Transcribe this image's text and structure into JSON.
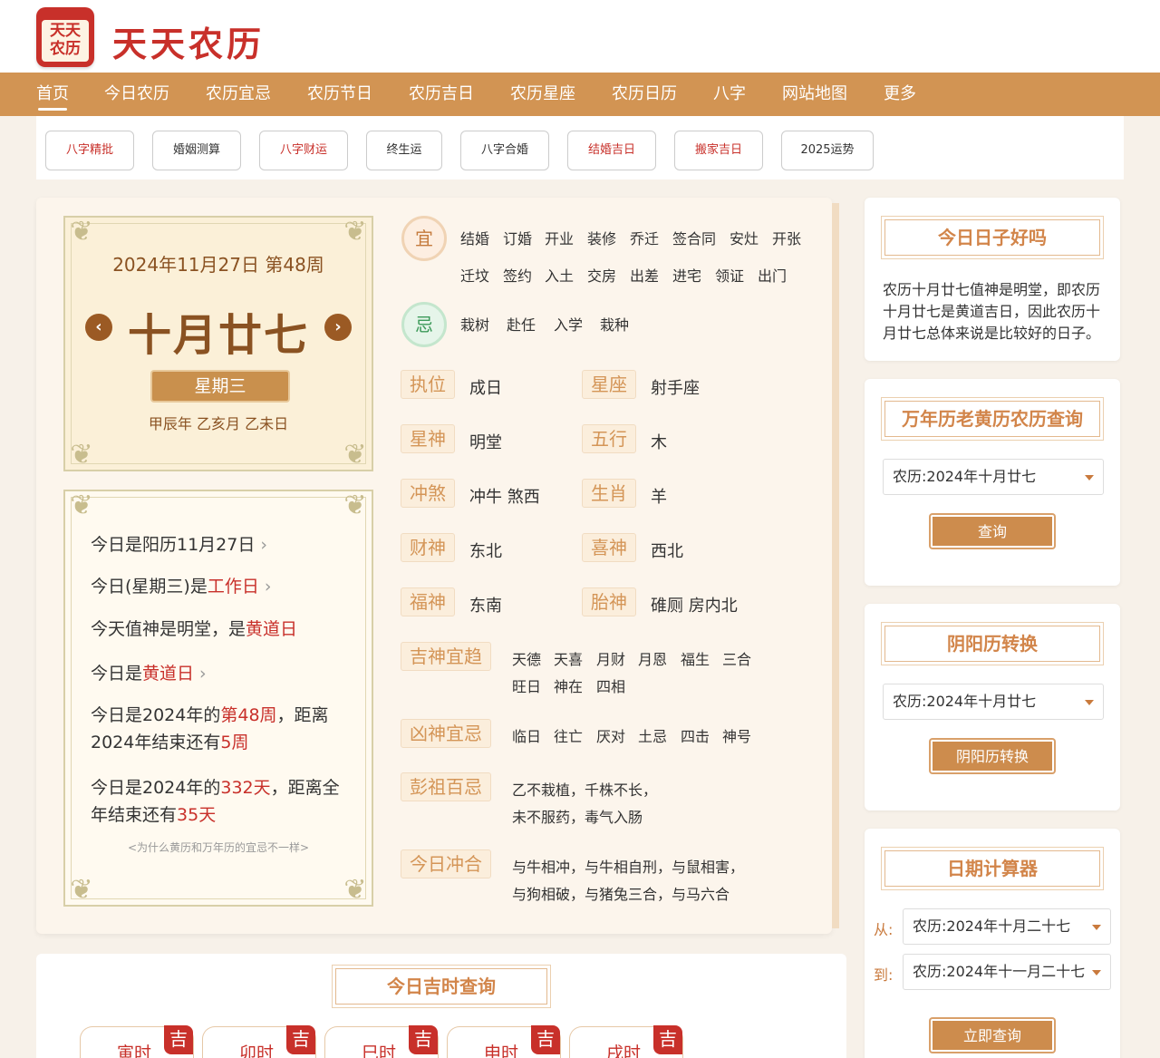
{
  "brand": {
    "logo_top": "天天",
    "logo_bottom": "农历",
    "title": "天天农历"
  },
  "nav": [
    "首页",
    "今日农历",
    "农历宜忌",
    "农历节日",
    "农历吉日",
    "农历星座",
    "农历日历",
    "八字",
    "网站地图",
    "更多"
  ],
  "subnav": [
    "八字精批",
    "婚姻测算",
    "八字财运",
    "终生运",
    "八字合婚",
    "结婚吉日",
    "搬家吉日",
    "2025运势"
  ],
  "date": {
    "solar": "2024年11月27日 第48周",
    "lunar": "十月廿七",
    "weekday": "星期三",
    "ganzhi": "甲辰年 乙亥月 乙未日",
    "prev": "‹",
    "next": "›"
  },
  "info": {
    "l1": "今日是阳历11月27日",
    "l2a": "今日(星期三)是",
    "l2b": "工作日",
    "l3a": "今天值神是明堂，是",
    "l3b": "黄道日",
    "l4a": "今日是",
    "l4b": "黄道日",
    "l5a": "今日是2024年的",
    "l5b": "第48周",
    "l5c": "，距离",
    "l5d": "2024年结束还有",
    "l5e": "5周",
    "l6a": "今日是2024年的",
    "l6b": "332天",
    "l6c": "，距离全",
    "l6d": "年结束还有",
    "l6e": "35天",
    "note": "<为什么黄历和万年历的宜忌不一样>"
  },
  "yi": {
    "label": "宜",
    "row1": [
      "结婚",
      "订婚",
      "开业",
      "装修",
      "乔迁",
      "签合同",
      "安灶",
      "开张"
    ],
    "row2": [
      "迁坟",
      "签约",
      "入土",
      "交房",
      "出差",
      "进宅",
      "领证",
      "出门"
    ]
  },
  "ji": {
    "label": "忌",
    "items": [
      "栽树",
      "赴任",
      "入学",
      "栽种"
    ]
  },
  "attrs": {
    "zhiwei": {
      "k": "执位",
      "v": "成日"
    },
    "xingzuo": {
      "k": "星座",
      "v": "射手座"
    },
    "xingshen": {
      "k": "星神",
      "v": "明堂"
    },
    "wuxing": {
      "k": "五行",
      "v": "木"
    },
    "chongsha": {
      "k": "冲煞",
      "v": "冲牛 煞西"
    },
    "shengxiao": {
      "k": "生肖",
      "v": "羊"
    },
    "caishen": {
      "k": "财神",
      "v": "东北"
    },
    "xishen": {
      "k": "喜神",
      "v": "西北"
    },
    "fushen": {
      "k": "福神",
      "v": "东南"
    },
    "taishen": {
      "k": "胎神",
      "v": "碓厕 房内北"
    }
  },
  "jishen": {
    "k": "吉神宜趋",
    "row1": [
      "天德",
      "天喜",
      "月财",
      "月恩",
      "福生",
      "三合"
    ],
    "row2": [
      "旺日",
      "神在",
      "四相"
    ]
  },
  "xiongshen": {
    "k": "凶神宜忌",
    "items": [
      "临日",
      "往亡",
      "厌对",
      "土忌",
      "四击",
      "神号"
    ]
  },
  "pengzu": {
    "k": "彭祖百忌",
    "l1": "乙不栽植，千株不长，",
    "l2": "未不服药，毒气入肠"
  },
  "chonghe": {
    "k": "今日冲合",
    "l1": "与牛相冲，与牛相自刑，与鼠相害，",
    "l2": "与狗相破，与猪兔三合，与马六合"
  },
  "jishi": {
    "title": "今日吉时查询",
    "tabs": [
      {
        "n": "寅时",
        "j": "吉"
      },
      {
        "n": "卯时",
        "j": "吉"
      },
      {
        "n": "巳时",
        "j": "吉"
      },
      {
        "n": "申时",
        "j": "吉"
      },
      {
        "n": "戌时",
        "j": "吉"
      }
    ]
  },
  "side": {
    "good": {
      "title": "今日日子好吗",
      "text": "农历十月廿七值神是明堂，即农历十月廿七是黄道吉日，因此农历十月廿七总体来说是比较好的日子。"
    },
    "query": {
      "title": "万年历老黄历农历查询",
      "select": "农历:2024年十月廿七",
      "button": "查询"
    },
    "convert": {
      "title": "阴阳历转换",
      "select": "农历:2024年十月廿七",
      "button": "阴阳历转换"
    },
    "calc": {
      "title": "日期计算器",
      "from_label": "从:",
      "from": "农历:2024年十月二十七",
      "to_label": "到:",
      "to": "农历:2024年十一月二十七",
      "button": "立即查询"
    }
  },
  "colors": {
    "brand_red": "#c8302a",
    "nav_gold": "#d29453",
    "tag_text": "#d49557"
  }
}
